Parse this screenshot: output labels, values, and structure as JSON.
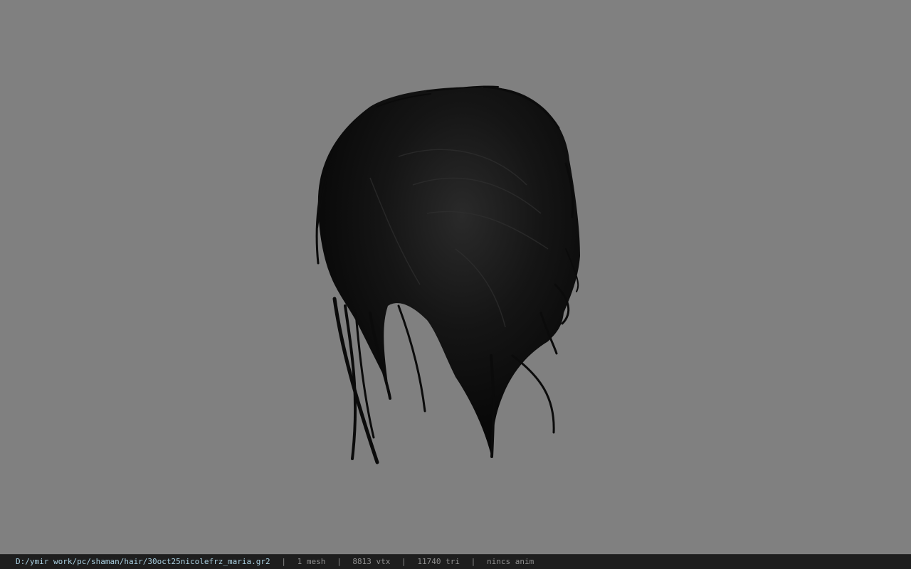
{
  "status_bar": {
    "file_path": "D:/ymir work/pc/shaman/hair/30oct25nicolefrz_maria.gr2",
    "separator": "|",
    "mesh_count": "1 mesh",
    "vertex_count": "8813 vtx",
    "triangle_count": "11740 tri",
    "animation": "nincs anim"
  },
  "viewport": {
    "background_color": "#808080",
    "model_color": "#0a0a0a",
    "model_subject": "hair-mesh"
  }
}
